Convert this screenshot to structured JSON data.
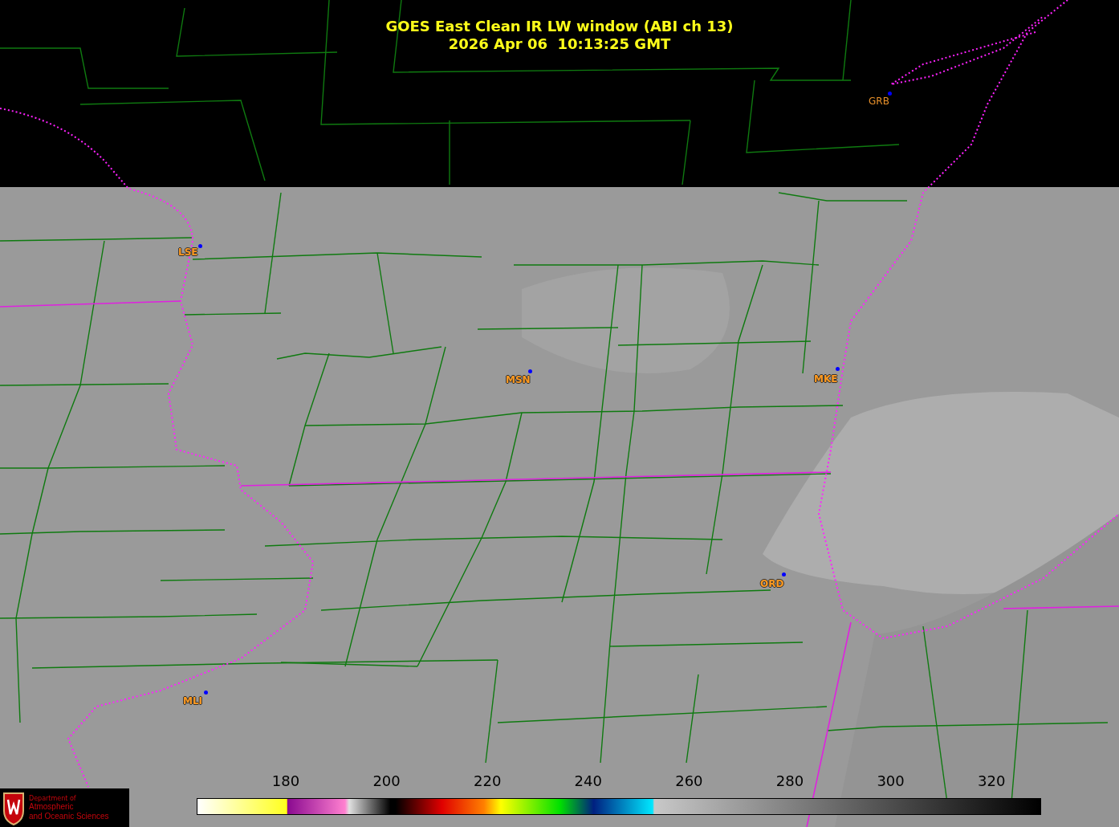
{
  "title": {
    "line_1": "GOES East Clean IR LW window (ABI ch 13)",
    "line_2": "2026 Apr 06  10:13:25 GMT"
  },
  "stations": [
    {
      "label": "GRB"
    },
    {
      "label": "LSE"
    },
    {
      "label": "MSN"
    },
    {
      "label": "MKE"
    },
    {
      "label": "ORD"
    },
    {
      "label": "MLI"
    }
  ],
  "colorbar": {
    "ticks": [
      "180",
      "200",
      "220",
      "240",
      "260",
      "280",
      "300",
      "320"
    ]
  },
  "logo": {
    "line_1": "Department of",
    "line_2": "Atmospheric",
    "line_3": "and Oceanic Sciences"
  }
}
